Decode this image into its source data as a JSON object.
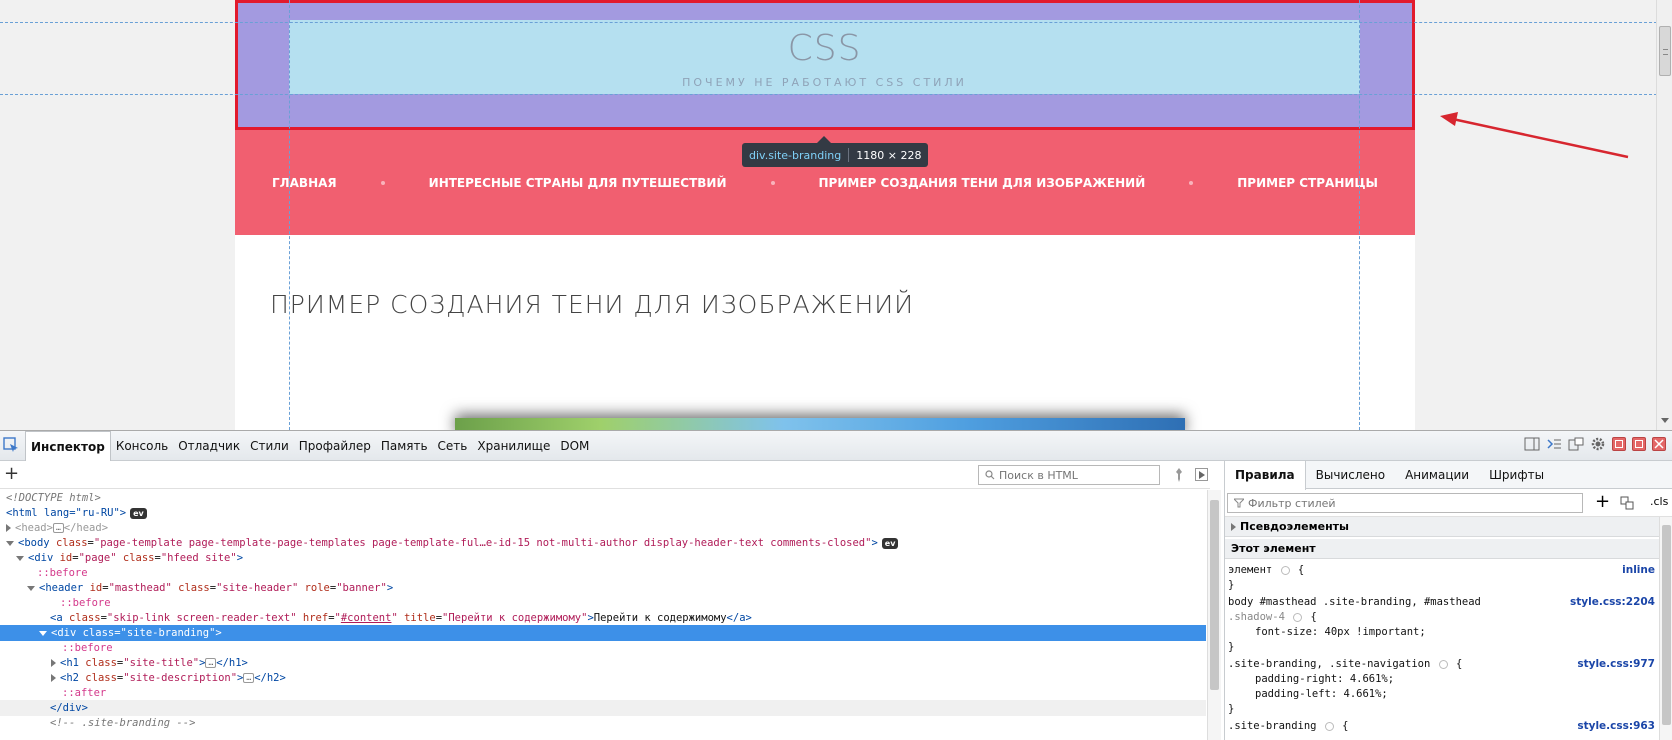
{
  "page": {
    "site_title": "CSS",
    "site_description": "ПОЧЕМУ НЕ РАБОТАЮТ CSS СТИЛИ",
    "highlight_tooltip": {
      "element": "div.site-branding",
      "size": "1180 × 228"
    },
    "nav_items": [
      "ГЛАВНАЯ",
      "ИНТЕРЕСНЫЕ СТРАНЫ ДЛЯ ПУТЕШЕСТВИЙ",
      "ПРИМЕР СОЗДАНИЯ ТЕНИ ДЛЯ ИЗОБРАЖЕНИЙ",
      "ПРИМЕР СТРАНИЦЫ"
    ],
    "content_title": "ПРИМЕР СОЗДАНИЯ ТЕНИ ДЛЯ ИЗОБРАЖЕНИЙ"
  },
  "devtools": {
    "tabs": [
      "Инспектор",
      "Консоль",
      "Отладчик",
      "Стили",
      "Профайлер",
      "Память",
      "Сеть",
      "Хранилище",
      "DOM"
    ],
    "active_tab": "Инспектор",
    "search_placeholder": "Поиск в HTML",
    "markup": {
      "doctype": "<!DOCTYPE html>",
      "html_open": "<html lang=\"ru-RU\">",
      "head": "<head>",
      "head_close": "</head>",
      "body_class": "page-template page-template-page-templates page-template-ful…e-id-15 not-multi-author display-header-text comments-closed",
      "page_id": "page",
      "page_class": "hfeed site",
      "before": "::before",
      "after": "::after",
      "header_id": "masthead",
      "header_class": "site-header",
      "header_role": "banner",
      "skip_class": "skip-link screen-reader-text",
      "skip_href": "#content",
      "skip_title": "Перейти к содержимому",
      "skip_text": "Перейти к содержимому",
      "branding_class": "site-branding",
      "h1_class": "site-title",
      "h2_class": "site-description",
      "div_close": "</div>",
      "comment": "<!-- .site-branding -->",
      "ev_badge": "ev"
    },
    "sidebar": {
      "tabs": [
        "Правила",
        "Вычислено",
        "Анимации",
        "Шрифты"
      ],
      "active_tab": "Правила",
      "filter_placeholder": "Фильтр стилей",
      "cls_label": ".cls",
      "pseudo_section": "Псевдоэлементы",
      "this_element_section": "Этот элемент",
      "rules": [
        {
          "selector": "элемент",
          "source": "inline",
          "props": []
        },
        {
          "selector": "body #masthead .site-branding, #masthead",
          "selector_cont": ".shadow-4",
          "source": "style.css:2204",
          "props": [
            "font-size: 40px !important;"
          ]
        },
        {
          "selector": ".site-branding, .site-navigation",
          "source": "style.css:977",
          "props": [
            "padding-right: 4.661%;",
            "padding-left: 4.661%;"
          ]
        },
        {
          "selector": ".site-branding",
          "source": "style.css:963",
          "props": []
        }
      ]
    }
  },
  "colors": {
    "masthead_overlay": "#a39ae0",
    "branding_content": "#b5e0f0",
    "nav_background": "#f15f70",
    "highlight_border": "#e21a2d",
    "selected_row": "#3d90e8",
    "annotation_arrow": "#d7262f"
  }
}
